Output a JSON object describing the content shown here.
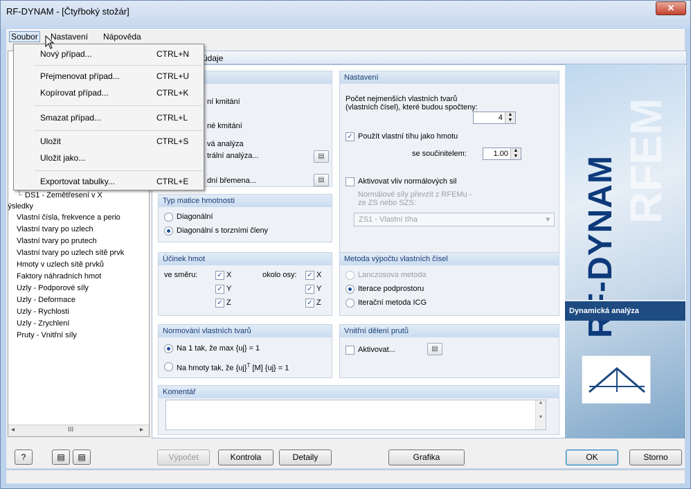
{
  "window": {
    "title": "RF-DYNAM - [Čtyřboký stožár]",
    "close_glyph": "✕"
  },
  "menubar": {
    "items": [
      "Soubor",
      "Nastavení",
      "Nápověda"
    ]
  },
  "file_menu": {
    "items": [
      {
        "label": "Nový případ...",
        "shortcut": "CTRL+N"
      },
      {
        "label": "Přejmenovat případ...",
        "shortcut": "CTRL+U"
      },
      {
        "label": "Kopírovat případ...",
        "shortcut": "CTRL+K"
      },
      {
        "label": "Smazat případ...",
        "shortcut": "CTRL+L"
      },
      {
        "label": "Uložit",
        "shortcut": "CTRL+S"
      },
      {
        "label": "Uložit jako...",
        "shortcut": ""
      },
      {
        "label": "Exportovat tabulky...",
        "shortcut": "CTRL+E"
      }
    ]
  },
  "tree": {
    "case_item": "DS1 - Zemětřesení v X",
    "results_header": "Výsledky",
    "results": [
      "Vlastní čísla, frekvence a perio",
      "Vlastní tvary po uzlech",
      "Vlastní tvary po prutech",
      "Vlastní tvary po uzlech sítě prvk",
      "Hmoty v uzlech sítě prvků",
      "Faktory náhradních hmot",
      "Uzly - Podporové síly",
      "Uzly - Deformace",
      "Uzly - Rychlosti",
      "Uzly - Zrychlení",
      "Pruty - Vnitřní síly"
    ],
    "scroll_thumb": "III"
  },
  "tab": {
    "label": "údaje"
  },
  "analysis_panel": {
    "items": [
      "ní kmitání",
      "né kmitání",
      "vá analýza",
      "trální analýza...",
      "dní břemena..."
    ]
  },
  "settings": {
    "header": "Nastavení",
    "modes_label": "Počet nejmenších vlastních tvarů (vlastních čísel), které budou spočteny:",
    "modes_value": "4",
    "self_weight_label": "Použít vlastní tíhu jako hmotu",
    "factor_label": "se součinitelem:",
    "factor_value": "1.00",
    "normal_forces_label": "Aktivovat vliv normálových sil",
    "transfer_label": "Normálové síly převzít z RFEMu - ze ZS nebo SZS:",
    "load_case": "ZS1 - Vlastní tíha"
  },
  "mass_matrix": {
    "header": "Typ matice hmotnosti",
    "options": [
      "Diagonální",
      "Diagonální s torzními členy"
    ]
  },
  "mass_effect": {
    "header": "Účinek hmot",
    "direction_label": "ve směru:",
    "axis_label": "okolo osy:",
    "axes": [
      "X",
      "Y",
      "Z"
    ]
  },
  "eigen_method": {
    "header": "Metoda výpočtu vlastních čísel",
    "options": [
      "Lanczosova metoda",
      "Iterace podprostoru",
      "Iterační metoda ICG"
    ]
  },
  "normalization": {
    "header": "Normování vlastních tvarů",
    "option1": "Na 1 tak, že max {uj} = 1",
    "option2_a": "Na hmoty tak, že {uj}",
    "option2_sup": "T",
    "option2_b": " [M] {uj} = 1"
  },
  "division": {
    "header": "Vnitřní dělení prutů",
    "activate_label": "Aktivovat..."
  },
  "comment": {
    "header": "Komentář"
  },
  "brand": {
    "product": "RF-DYNAM",
    "ghost": "RFEM",
    "caption": "Dynamická analýza"
  },
  "buttons": {
    "calc": "Výpočet",
    "check": "Kontrola",
    "details": "Detaily",
    "graphics": "Grafika",
    "ok": "OK",
    "cancel": "Storno"
  },
  "glyphs": {
    "check": "✓",
    "up": "▲",
    "down": "▼",
    "drop": "▾",
    "left": "◂",
    "right": "▸",
    "help": "?",
    "tool": "▤"
  }
}
